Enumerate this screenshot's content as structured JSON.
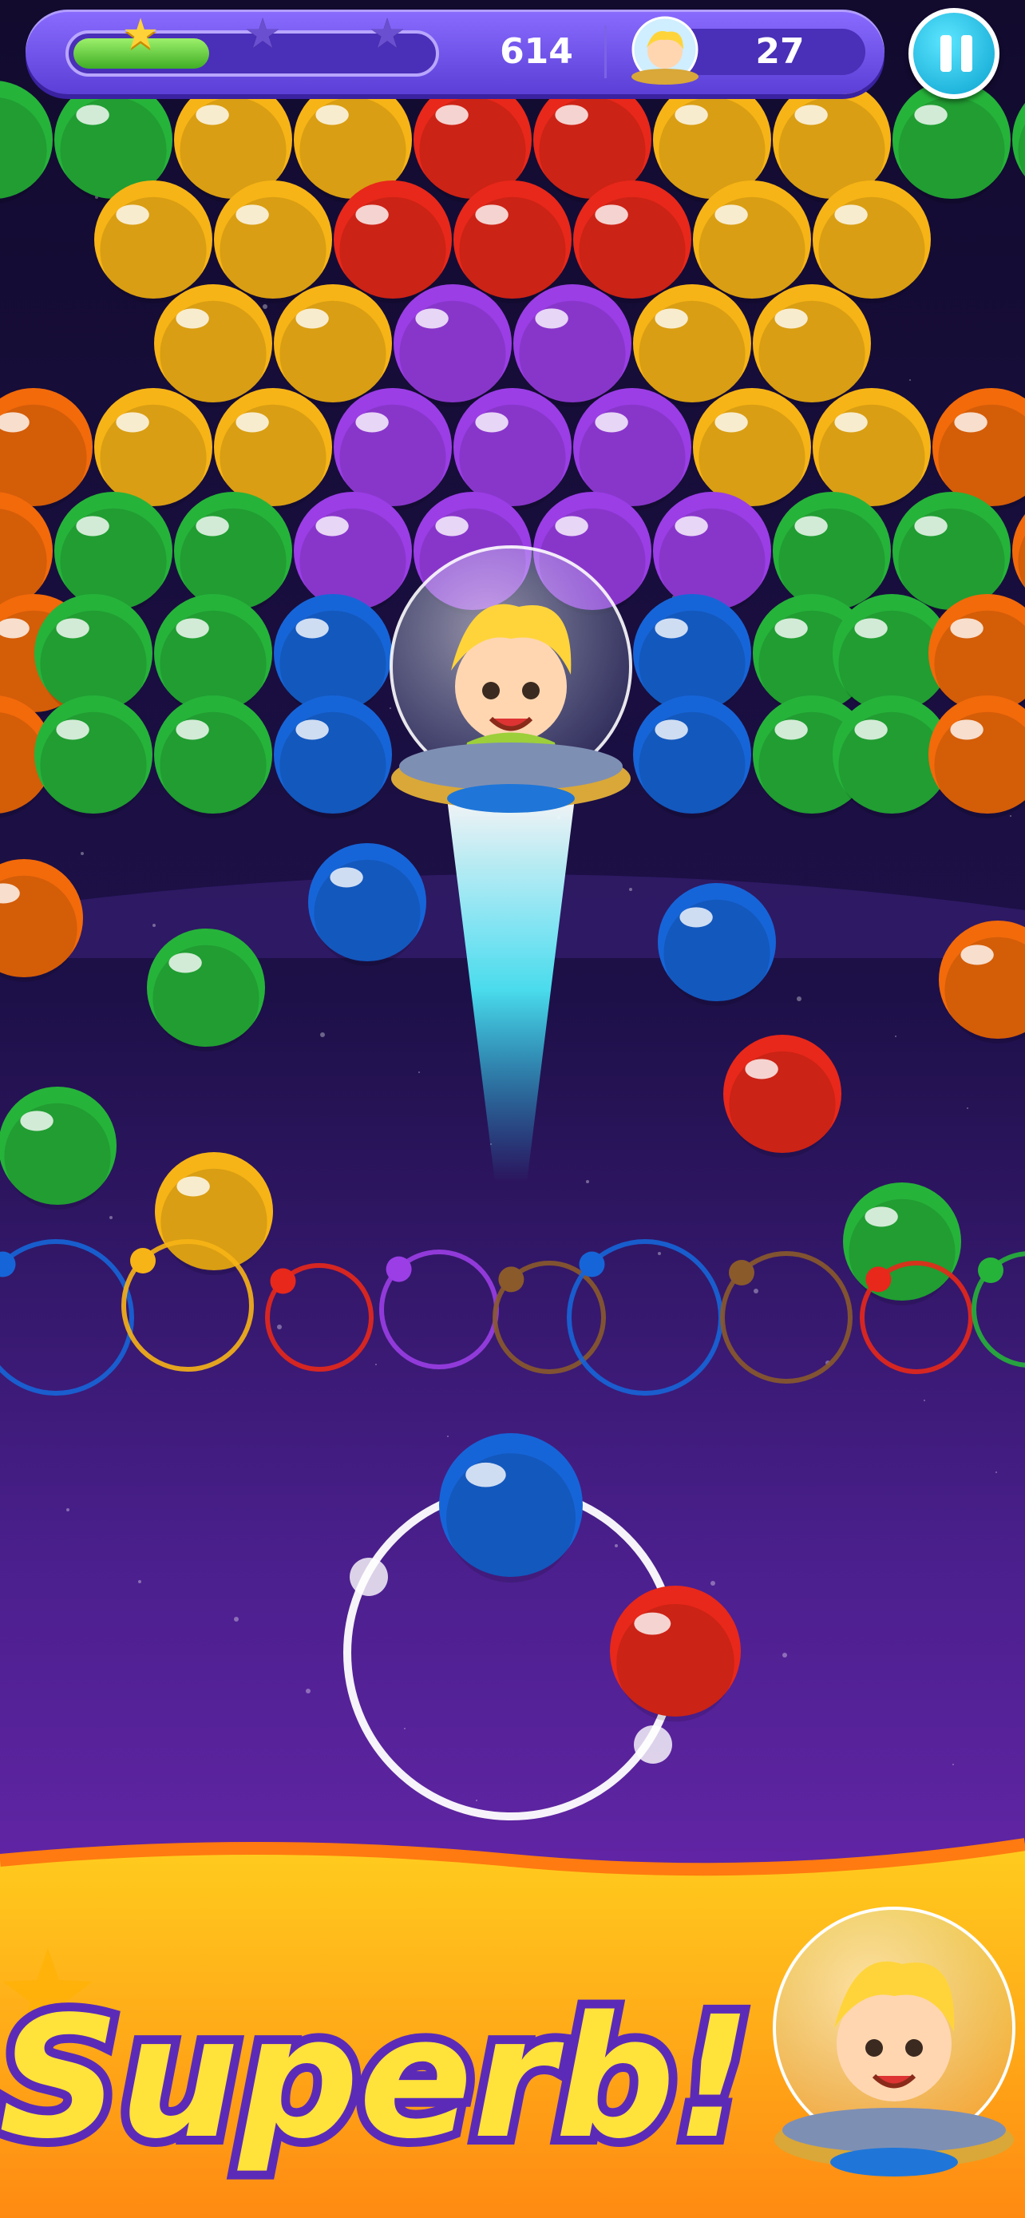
{
  "hud": {
    "score": "614",
    "moves": "27",
    "progress": 0.38,
    "stars": [
      {
        "name": "star-1",
        "earned": true
      },
      {
        "name": "star-2",
        "earned": false
      },
      {
        "name": "star-3",
        "earned": false
      }
    ],
    "pause_icon": "pause-icon"
  },
  "banner": {
    "message": "Superb!"
  },
  "colors": {
    "red": "#e8281a",
    "orange": "#f26a0a",
    "yellow": "#f7b416",
    "green": "#26b33a",
    "purple": "#9b3ee6",
    "blue": "#1665d8",
    "brown": "#8a5a2b"
  },
  "grid": {
    "rows": [
      [
        "green",
        "green",
        "yellow",
        "yellow",
        "red",
        "red",
        "yellow",
        "yellow",
        "green",
        "green"
      ],
      [
        "yellow",
        "yellow",
        "red",
        "red",
        "red",
        "yellow",
        "yellow"
      ],
      [
        "yellow",
        "yellow",
        "purple",
        "purple",
        "yellow",
        "yellow"
      ],
      [
        "orange",
        "yellow",
        "yellow",
        "purple",
        "purple",
        "purple",
        "yellow",
        "yellow",
        "orange"
      ],
      [
        "orange",
        "green",
        "green",
        "purple",
        "purple",
        "purple",
        "purple",
        "green",
        "green",
        "orange"
      ],
      [
        "orange",
        "green",
        "green",
        "blue",
        "blue",
        "green",
        "green",
        "orange"
      ],
      [
        "orange",
        "green",
        "green",
        "blue",
        "blue",
        "green",
        "green",
        "orange"
      ]
    ]
  },
  "falling": [
    "orange",
    "blue",
    "blue",
    "green",
    "orange",
    "red",
    "green",
    "yellow",
    "green"
  ],
  "ring_colors": [
    "blue",
    "yellow",
    "red",
    "purple",
    "brown",
    "blue",
    "brown",
    "red",
    "green"
  ],
  "shooter": {
    "current": "blue",
    "next": "red"
  }
}
